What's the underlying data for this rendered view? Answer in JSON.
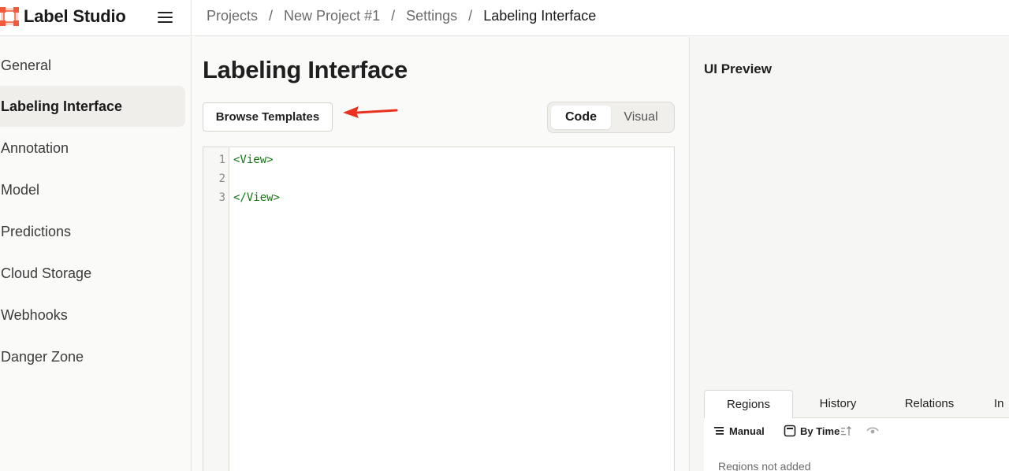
{
  "app": {
    "name": "Label Studio"
  },
  "breadcrumb": [
    {
      "label": "Projects"
    },
    {
      "label": "New Project #1"
    },
    {
      "label": "Settings"
    },
    {
      "label": "Labeling Interface"
    }
  ],
  "breadcrumb_separator": "/",
  "sidebar": {
    "active_index": 1,
    "items": [
      {
        "label": "General"
      },
      {
        "label": "Labeling Interface"
      },
      {
        "label": "Annotation"
      },
      {
        "label": "Model"
      },
      {
        "label": "Predictions"
      },
      {
        "label": "Cloud Storage"
      },
      {
        "label": "Webhooks"
      },
      {
        "label": "Danger Zone"
      }
    ]
  },
  "main": {
    "title": "Labeling Interface",
    "browse_templates_label": "Browse Templates",
    "toggle": {
      "code_label": "Code",
      "visual_label": "Visual",
      "selected": "Code"
    },
    "editor": {
      "lines": [
        {
          "number": "1",
          "text": "<View>"
        },
        {
          "number": "2",
          "text": ""
        },
        {
          "number": "3",
          "text": "</View>"
        }
      ]
    }
  },
  "preview": {
    "title": "UI Preview",
    "tabs": [
      {
        "label": "Regions"
      },
      {
        "label": "History"
      },
      {
        "label": "Relations"
      },
      {
        "label": "In"
      }
    ],
    "active_tab": "Regions",
    "controls": {
      "manual_label": "Manual",
      "by_time_label": "By Time"
    },
    "empty_message": "Regions not added"
  },
  "colors": {
    "brand": "#f15a3a",
    "annotation_arrow": "#e8311f",
    "code_tag": "#117711",
    "active_nav_bg": "#efeeeb"
  },
  "icons": {
    "logo": "label-studio-logo-icon",
    "menu": "hamburger-menu-icon",
    "arrow": "red-arrow-annotation-icon",
    "manual": "list-order-icon",
    "by_time": "clock-icon",
    "sort": "sort-direction-icon",
    "visibility": "eye-icon"
  }
}
